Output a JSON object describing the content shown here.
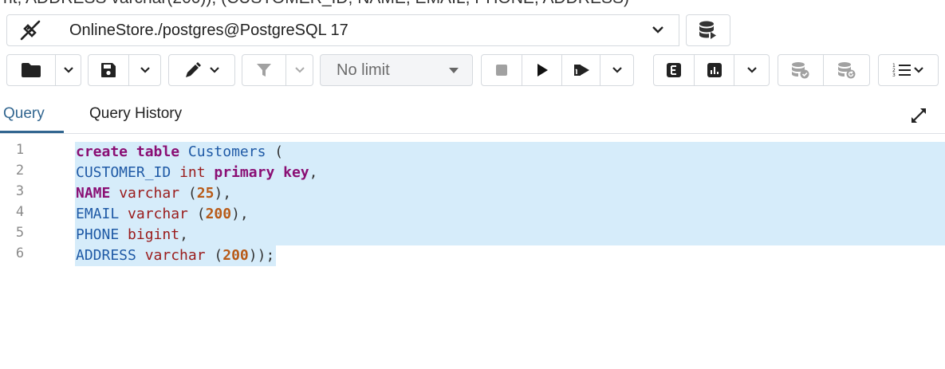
{
  "top_fragment": "nt,     ADDRESS varchar(200));         (CUSTOMER_ID, NAME, EMAIL, PHONE, ADDRESS)",
  "connection": {
    "label": "OnlineStore./postgres@PostgreSQL 17",
    "icons": {
      "connect": "plug-disconnected-icon",
      "dropdown": "chevron-down-icon",
      "database": "database-forward-icon"
    }
  },
  "toolbar": {
    "limit_label": "No limit",
    "icons": [
      "folder-icon",
      "save-icon",
      "edit-pen-icon",
      "filter-icon",
      "stop-icon",
      "play-icon",
      "execute-script-icon",
      "explain-icon",
      "explain-analyze-icon",
      "commit-icon",
      "rollback-icon",
      "macros-icon"
    ]
  },
  "tabs": {
    "query": "Query",
    "history": "Query History"
  },
  "editor": {
    "line_numbers": [
      "1",
      "2",
      "3",
      "4",
      "5",
      "6"
    ],
    "lines": [
      [
        {
          "t": "create table",
          "c": "kw"
        },
        {
          "t": " ",
          "c": "punct"
        },
        {
          "t": "Customers",
          "c": "id"
        },
        {
          "t": " (",
          "c": "punct"
        }
      ],
      [
        {
          "t": "CUSTOMER_ID",
          "c": "id"
        },
        {
          "t": " ",
          "c": "punct"
        },
        {
          "t": "int",
          "c": "type"
        },
        {
          "t": " ",
          "c": "punct"
        },
        {
          "t": "primary key",
          "c": "kw"
        },
        {
          "t": ",",
          "c": "punct"
        }
      ],
      [
        {
          "t": "NAME",
          "c": "kw"
        },
        {
          "t": " ",
          "c": "punct"
        },
        {
          "t": "varchar",
          "c": "type"
        },
        {
          "t": " (",
          "c": "punct"
        },
        {
          "t": "25",
          "c": "num"
        },
        {
          "t": "),",
          "c": "punct"
        }
      ],
      [
        {
          "t": "EMAIL",
          "c": "id"
        },
        {
          "t": " ",
          "c": "punct"
        },
        {
          "t": "varchar",
          "c": "type"
        },
        {
          "t": " (",
          "c": "punct"
        },
        {
          "t": "200",
          "c": "num"
        },
        {
          "t": "),",
          "c": "punct"
        }
      ],
      [
        {
          "t": "PHONE",
          "c": "id"
        },
        {
          "t": " ",
          "c": "punct"
        },
        {
          "t": "bigint",
          "c": "type"
        },
        {
          "t": ",",
          "c": "punct"
        }
      ],
      [
        {
          "t": "ADDRESS",
          "c": "id"
        },
        {
          "t": " ",
          "c": "punct"
        },
        {
          "t": "varchar",
          "c": "type"
        },
        {
          "t": " (",
          "c": "punct"
        },
        {
          "t": "200",
          "c": "num"
        },
        {
          "t": "));",
          "c": "punct"
        }
      ]
    ],
    "colors": {
      "selection": "#d6ecfa",
      "keyword": "#8a0f74",
      "type": "#9a1b1b",
      "identifier": "#1f5aa6",
      "number": "#b85a17",
      "accent": "#326690"
    }
  }
}
